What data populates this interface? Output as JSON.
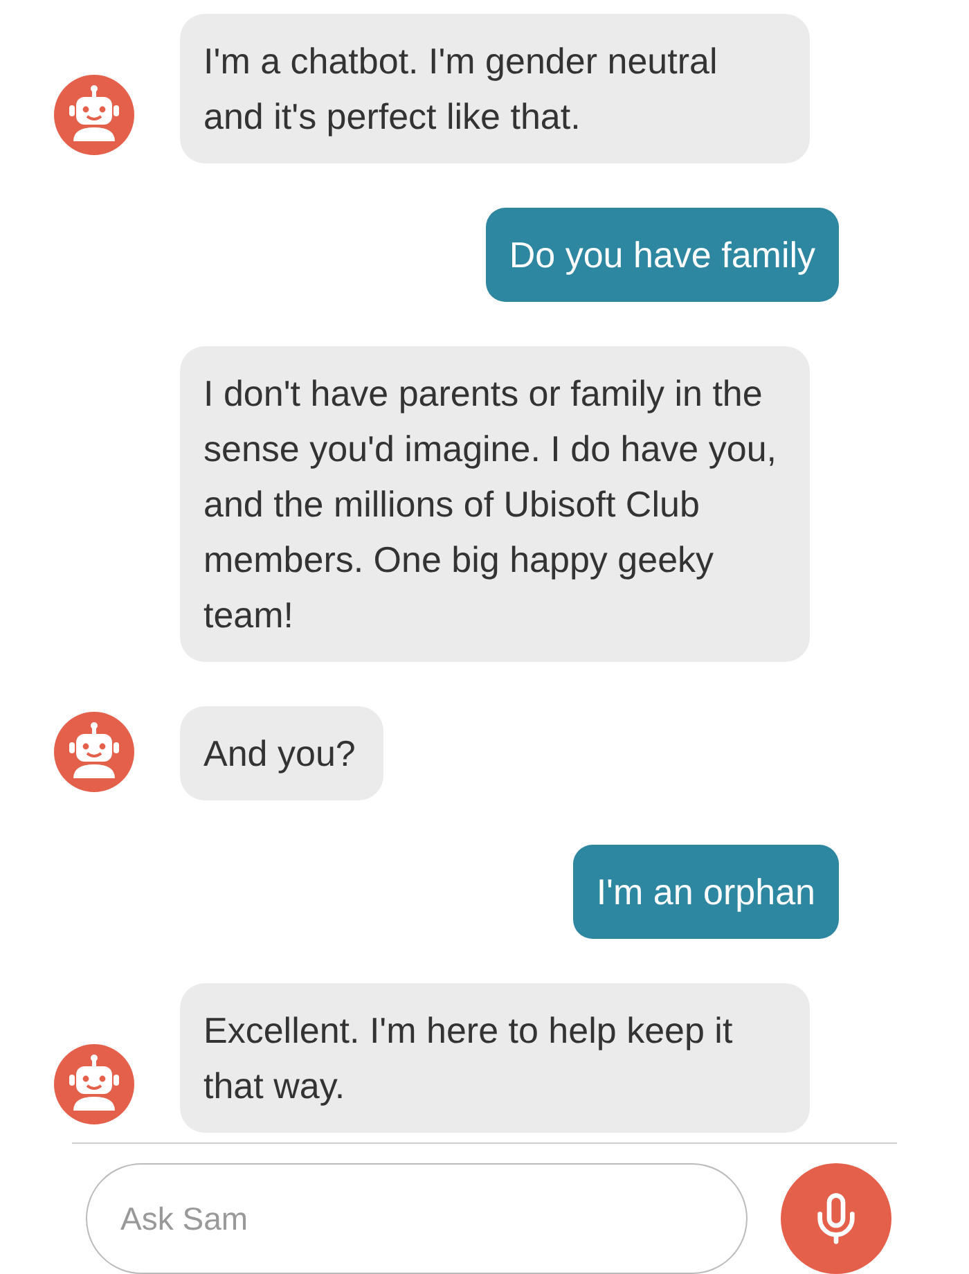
{
  "messages": [
    {
      "kind": "bot",
      "avatar": true,
      "text": "I'm a chatbot. I'm gender neutral and it's perfect like that."
    },
    {
      "kind": "user",
      "text": "Do you have family"
    },
    {
      "kind": "bot",
      "avatar": false,
      "text": "I don't have parents or family in the sense you'd imagine. I do have you, and the millions of Ubisoft Club members. One big happy geeky team!"
    },
    {
      "kind": "bot",
      "avatar": true,
      "text": "And you?"
    },
    {
      "kind": "user",
      "text": "I'm an orphan"
    },
    {
      "kind": "bot",
      "avatar": true,
      "text": "Excellent. I'm here to help keep it that way."
    }
  ],
  "composer": {
    "placeholder": "Ask Sam"
  }
}
